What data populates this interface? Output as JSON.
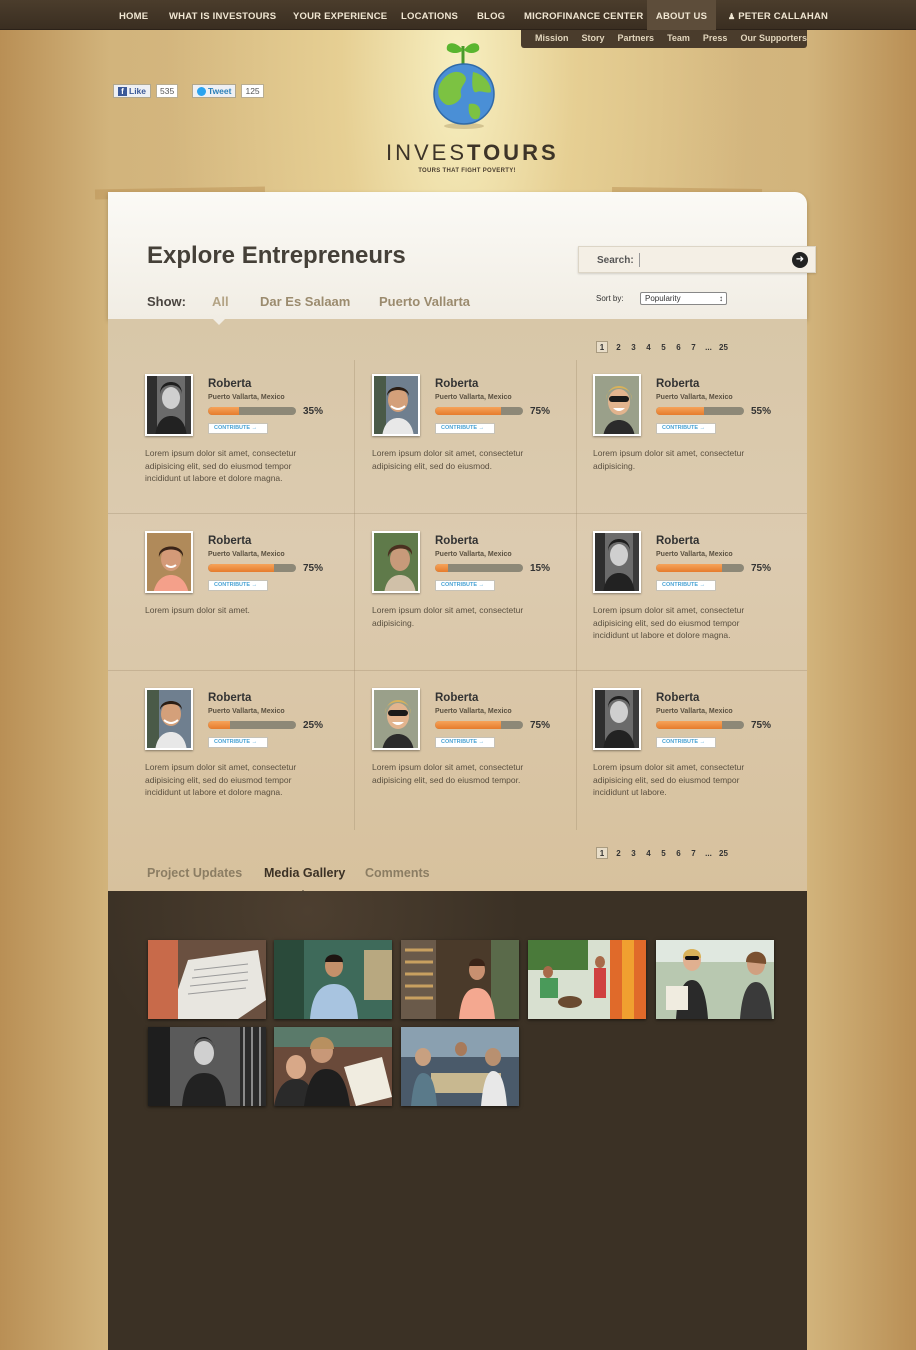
{
  "nav": {
    "items": [
      "Home",
      "What is Investours",
      "Your Experience",
      "Locations",
      "Blog",
      "Microfinance Center",
      "About Us"
    ],
    "active": "About Us",
    "user": "Peter Callahan",
    "subnav": [
      "Mission",
      "Story",
      "Partners",
      "Team",
      "Press",
      "Our Supporters"
    ]
  },
  "social": {
    "like_label": "Like",
    "like_count": "535",
    "tweet_label": "Tweet",
    "tweet_count": "125"
  },
  "logo": {
    "light": "INVES",
    "bold": "TOURS",
    "tagline": "TOURS THAT FIGHT POVERTY!"
  },
  "page": {
    "title": "Explore Entrepreneurs",
    "search_label": "Search:",
    "search_value": "",
    "show_label": "Show:",
    "filters": [
      "All",
      "Dar Es Salaam",
      "Puerto Vallarta"
    ],
    "active_filter": "All",
    "sort_label": "Sort by:",
    "sort_value": "Popularity"
  },
  "pagination": [
    "1",
    "2",
    "3",
    "4",
    "5",
    "6",
    "7",
    "...",
    "25"
  ],
  "contribute_label": "CONTRIBUTE →",
  "entrepreneurs": [
    {
      "name": "Roberta",
      "location": "Puerto Vallarta, Mexico",
      "percent": "35%",
      "progress": 0.35,
      "description": "Lorem ipsum dolor sit amet, consectetur adipisicing elit, sed do eiusmod tempor incididunt ut labore et dolore magna."
    },
    {
      "name": "Roberta",
      "location": "Puerto Vallarta, Mexico",
      "percent": "75%",
      "progress": 0.75,
      "description": "Lorem ipsum dolor sit amet, consectetur adipisicing elit, sed do eiusmod."
    },
    {
      "name": "Roberta",
      "location": "Puerto Vallarta, Mexico",
      "percent": "55%",
      "progress": 0.55,
      "description": "Lorem ipsum dolor sit amet, consectetur adipisicing."
    },
    {
      "name": "Roberta",
      "location": "Puerto Vallarta, Mexico",
      "percent": "75%",
      "progress": 0.75,
      "description": "Lorem ipsum dolor sit amet."
    },
    {
      "name": "Roberta",
      "location": "Puerto Vallarta, Mexico",
      "percent": "15%",
      "progress": 0.15,
      "description": "Lorem ipsum dolor sit amet, consectetur adipisicing."
    },
    {
      "name": "Roberta",
      "location": "Puerto Vallarta, Mexico",
      "percent": "75%",
      "progress": 0.75,
      "description": "Lorem ipsum dolor sit amet, consectetur adipisicing elit, sed do eiusmod tempor incididunt ut labore et dolore magna."
    },
    {
      "name": "Roberta",
      "location": "Puerto Vallarta, Mexico",
      "percent": "25%",
      "progress": 0.25,
      "description": "Lorem ipsum dolor sit amet, consectetur adipisicing elit, sed do eiusmod tempor incididunt ut labore et dolore magna."
    },
    {
      "name": "Roberta",
      "location": "Puerto Vallarta, Mexico",
      "percent": "75%",
      "progress": 0.75,
      "description": "Lorem ipsum dolor sit amet, consectetur adipisicing elit, sed do eiusmod tempor."
    },
    {
      "name": "Roberta",
      "location": "Puerto Vallarta, Mexico",
      "percent": "75%",
      "progress": 0.75,
      "description": "Lorem ipsum dolor sit amet, consectetur adipisicing elit, sed do eiusmod tempor incididunt ut labore."
    }
  ],
  "tabs": [
    "Project Updates",
    "Media Gallery",
    "Comments"
  ],
  "active_tab": "Media Gallery",
  "colors": {
    "nav_bg": "#3a2e21",
    "progress_fill": "#e67c2c",
    "progress_track": "#8d8877",
    "gallery_bg": "#3b3125",
    "contribute_text": "#4aa3d4"
  }
}
